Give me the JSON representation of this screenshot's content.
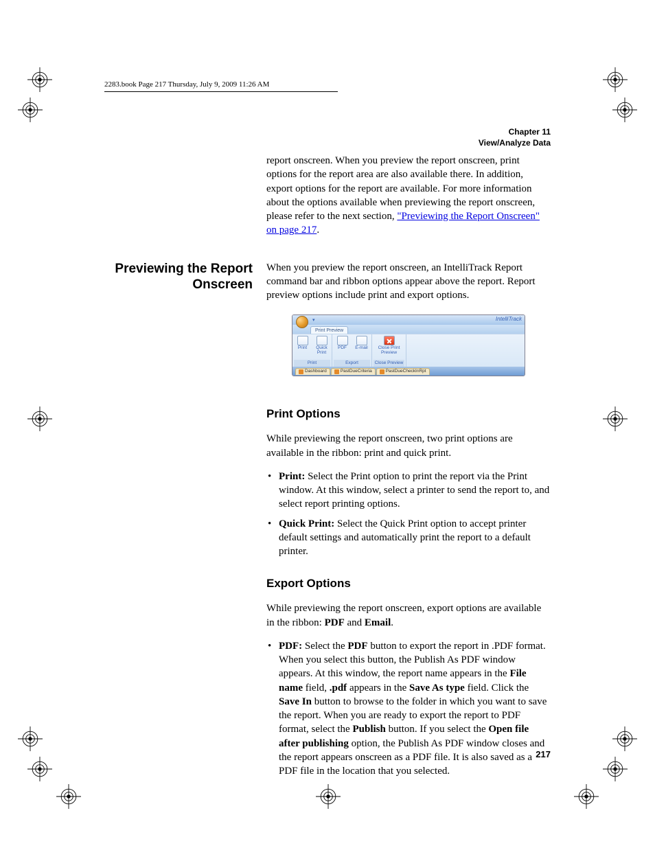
{
  "running_head": "2283.book  Page 217  Thursday, July 9, 2009  11:26 AM",
  "chapter_line1": "Chapter 11",
  "chapter_line2": "View/Analyze Data",
  "intro_para_pre": "report onscreen. When you preview the report onscreen, print options for the report area are also available there. In addition, export options for the report are available. For more information about the options available when previewing the report onscreen, please refer to the next section, ",
  "intro_link": "\"Previewing the Report Onscreen\" on page 217",
  "intro_para_post": ".",
  "side_heading": "Previewing the Report Onscreen",
  "preview_para": "When you preview the report onscreen, an IntelliTrack Report command bar and ribbon options appear above the report. Report preview options include print and export options.",
  "ss": {
    "brand": "IntelliTrack",
    "tab": "Print Preview",
    "btn_print": "Print",
    "btn_quick": "Quick Print",
    "btn_pdf": "PDF",
    "btn_email": "E-mail",
    "btn_close": "Close Print Preview",
    "grp_print": "Print",
    "grp_export": "Export",
    "grp_close": "Close Preview",
    "doc1": "Dashboard",
    "doc2": "PastDueCriteria",
    "doc3": "PastDueCheckInRpt"
  },
  "h_print": "Print Options",
  "p_print_intro": "While previewing the report onscreen, two print options are available in the ribbon: print and quick print.",
  "li_print_b": "Print:",
  "li_print_t": " Select the Print option to print the report via the Print window. At this window, select a printer to send the report to, and select report printing options.",
  "li_qp_b": "Quick Print:",
  "li_qp_t": " Select the Quick Print option to accept printer default settings and automatically print the report to a default printer.",
  "h_export": "Export Options",
  "p_export_pre": "While previewing the report onscreen, export options are available in the ribbon: ",
  "b_pdf_word": "PDF",
  "and_word": " and ",
  "b_email_word": "Email",
  "period": ".",
  "li_pdf": {
    "b1": "PDF:",
    "t1": " Select the ",
    "b2": "PDF",
    "t2": " button to export the report in .PDF format. When you select this button, the Publish As PDF window appears. At this window, the report name appears in the ",
    "b3": "File name",
    "t3": " field, ",
    "b4": ".pdf",
    "t4": " appears in the ",
    "b5": "Save As type",
    "t5": " field. Click the ",
    "b6": "Save In",
    "t6": " button to browse to the folder in which you want to save the report. When you are ready to export the report to PDF format, select the ",
    "b7": "Publish",
    "t7": " button. If you select the ",
    "b8": "Open file after publishing",
    "t8": " option, the Publish As PDF window closes and the report appears onscreen as a PDF file. It is also saved as a PDF file in the location that you selected."
  },
  "page_number": "217"
}
